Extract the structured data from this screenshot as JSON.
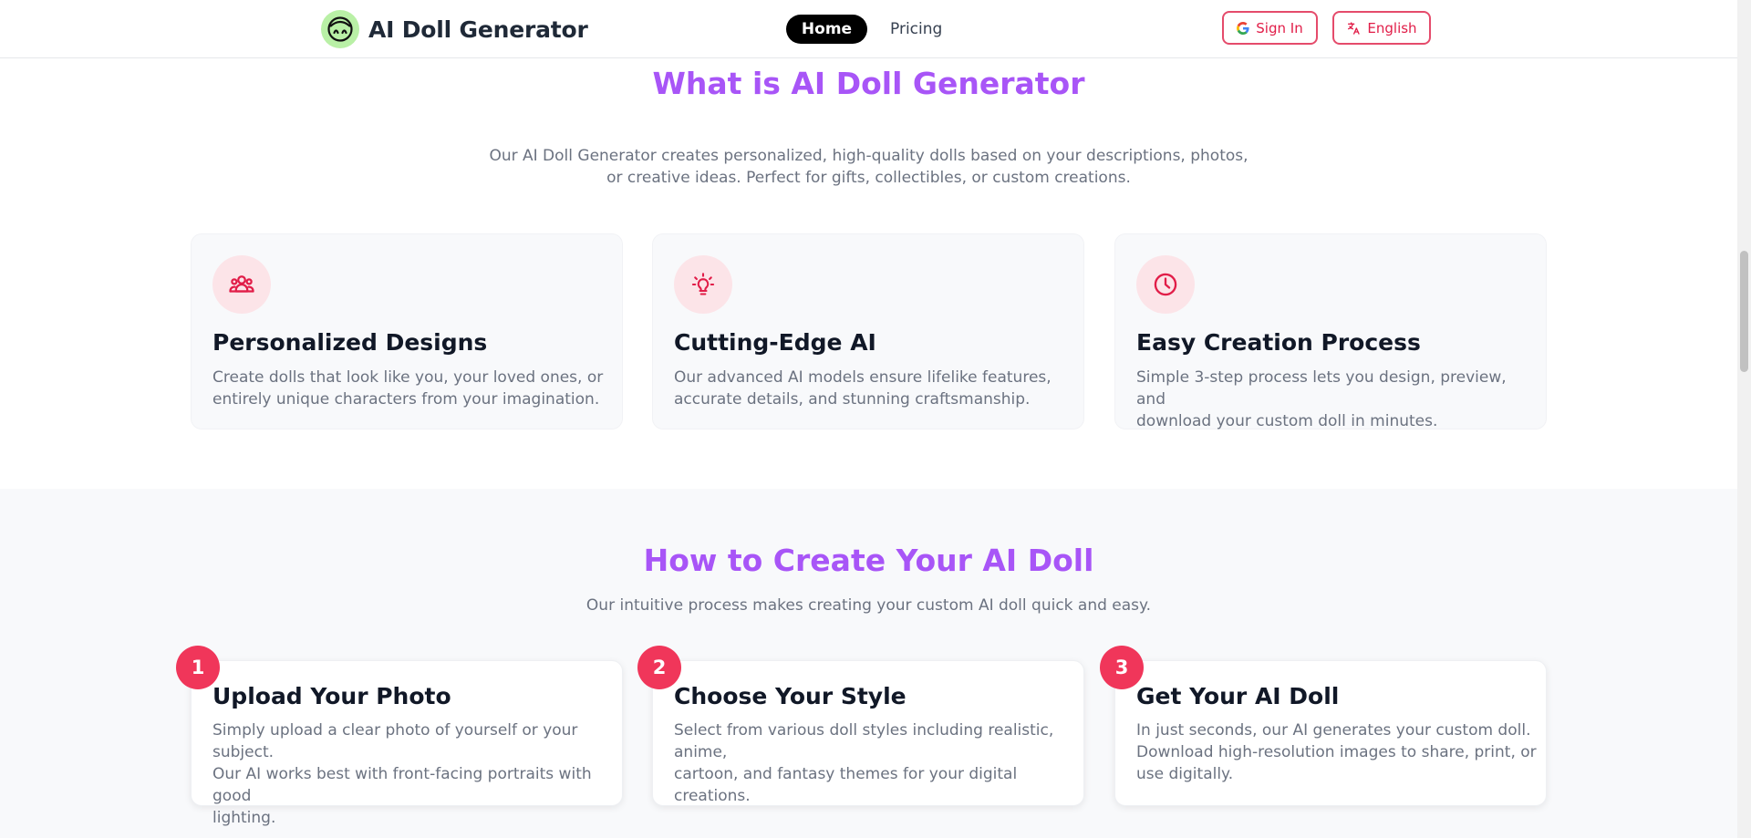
{
  "header": {
    "brand": "AI Doll Generator",
    "logo_icon": "doll-face-icon",
    "nav": {
      "home": "Home",
      "pricing": "Pricing"
    },
    "sign_in": "Sign In",
    "language": "English"
  },
  "what_is": {
    "title": "What is AI Doll Generator",
    "description_line1": "Our AI Doll Generator creates personalized, high-quality dolls based on your descriptions, photos,",
    "description_line2": "or creative ideas. Perfect for gifts, collectibles, or custom creations.",
    "features": [
      {
        "icon": "users-icon",
        "title": "Personalized Designs",
        "line1": "Create dolls that look like you, your loved ones, or",
        "line2": "entirely unique characters from your imagination."
      },
      {
        "icon": "lightbulb-icon",
        "title": "Cutting-Edge AI",
        "line1": "Our advanced AI models ensure lifelike features,",
        "line2": "accurate details, and stunning craftsmanship."
      },
      {
        "icon": "clock-icon",
        "title": "Easy Creation Process",
        "line1": "Simple 3-step process lets you design, preview, and",
        "line2": "download your custom doll in minutes."
      }
    ]
  },
  "how_to": {
    "title": "How to Create Your AI Doll",
    "description": "Our intuitive process makes creating your custom AI doll quick and easy.",
    "steps": [
      {
        "number": "1",
        "title": "Upload Your Photo",
        "line1": "Simply upload a clear photo of yourself or your subject.",
        "line2": "Our AI works best with front-facing portraits with good",
        "line3": "lighting."
      },
      {
        "number": "2",
        "title": "Choose Your Style",
        "line1": "Select from various doll styles including realistic, anime,",
        "line2": "cartoon, and fantasy themes for your digital creations.",
        "line3": ""
      },
      {
        "number": "3",
        "title": "Get Your AI Doll",
        "line1": "In just seconds, our AI generates your custom doll.",
        "line2": "Download high-resolution images to share, print, or",
        "line3": "use digitally."
      }
    ]
  },
  "colors": {
    "accent_purple": "#a855f7",
    "accent_rose": "#f0365a",
    "icon_bg": "#fce4e8"
  }
}
